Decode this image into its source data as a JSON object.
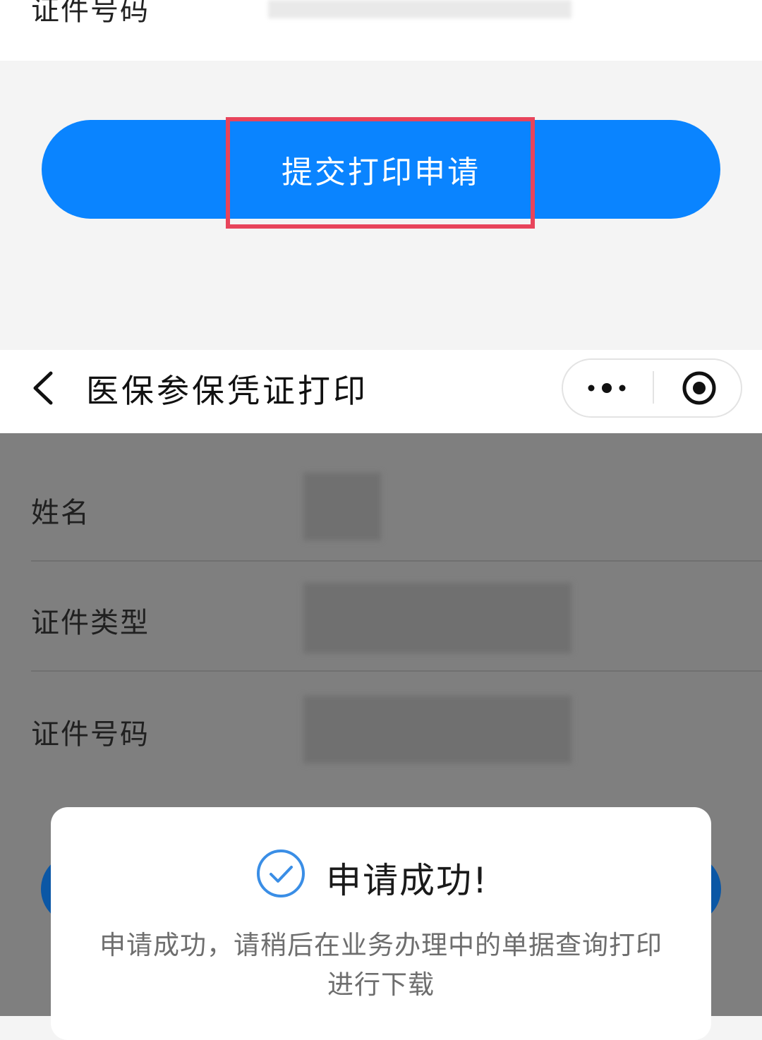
{
  "top_form": {
    "id_number_label": "证件号码"
  },
  "submit_button": {
    "label": "提交打印申请"
  },
  "nav": {
    "title": "医保参保凭证打印",
    "back_icon": "chevron-left-icon",
    "more_icon": "more-dots-icon",
    "close_icon": "target-circle-icon"
  },
  "form": {
    "fields": [
      {
        "label": "姓名"
      },
      {
        "label": "证件类型"
      },
      {
        "label": "证件号码"
      }
    ]
  },
  "modal": {
    "icon": "check-circle-icon",
    "title": "申请成功!",
    "message_line1": "申请成功，请稍后在业务办理中的单据查询打印",
    "message_line2": "进行下载"
  },
  "colors": {
    "primary_button": "#0a84ff",
    "highlight_border": "#e8445b",
    "overlay": "#7f7f7f",
    "check_icon": "#3a8ee6"
  }
}
